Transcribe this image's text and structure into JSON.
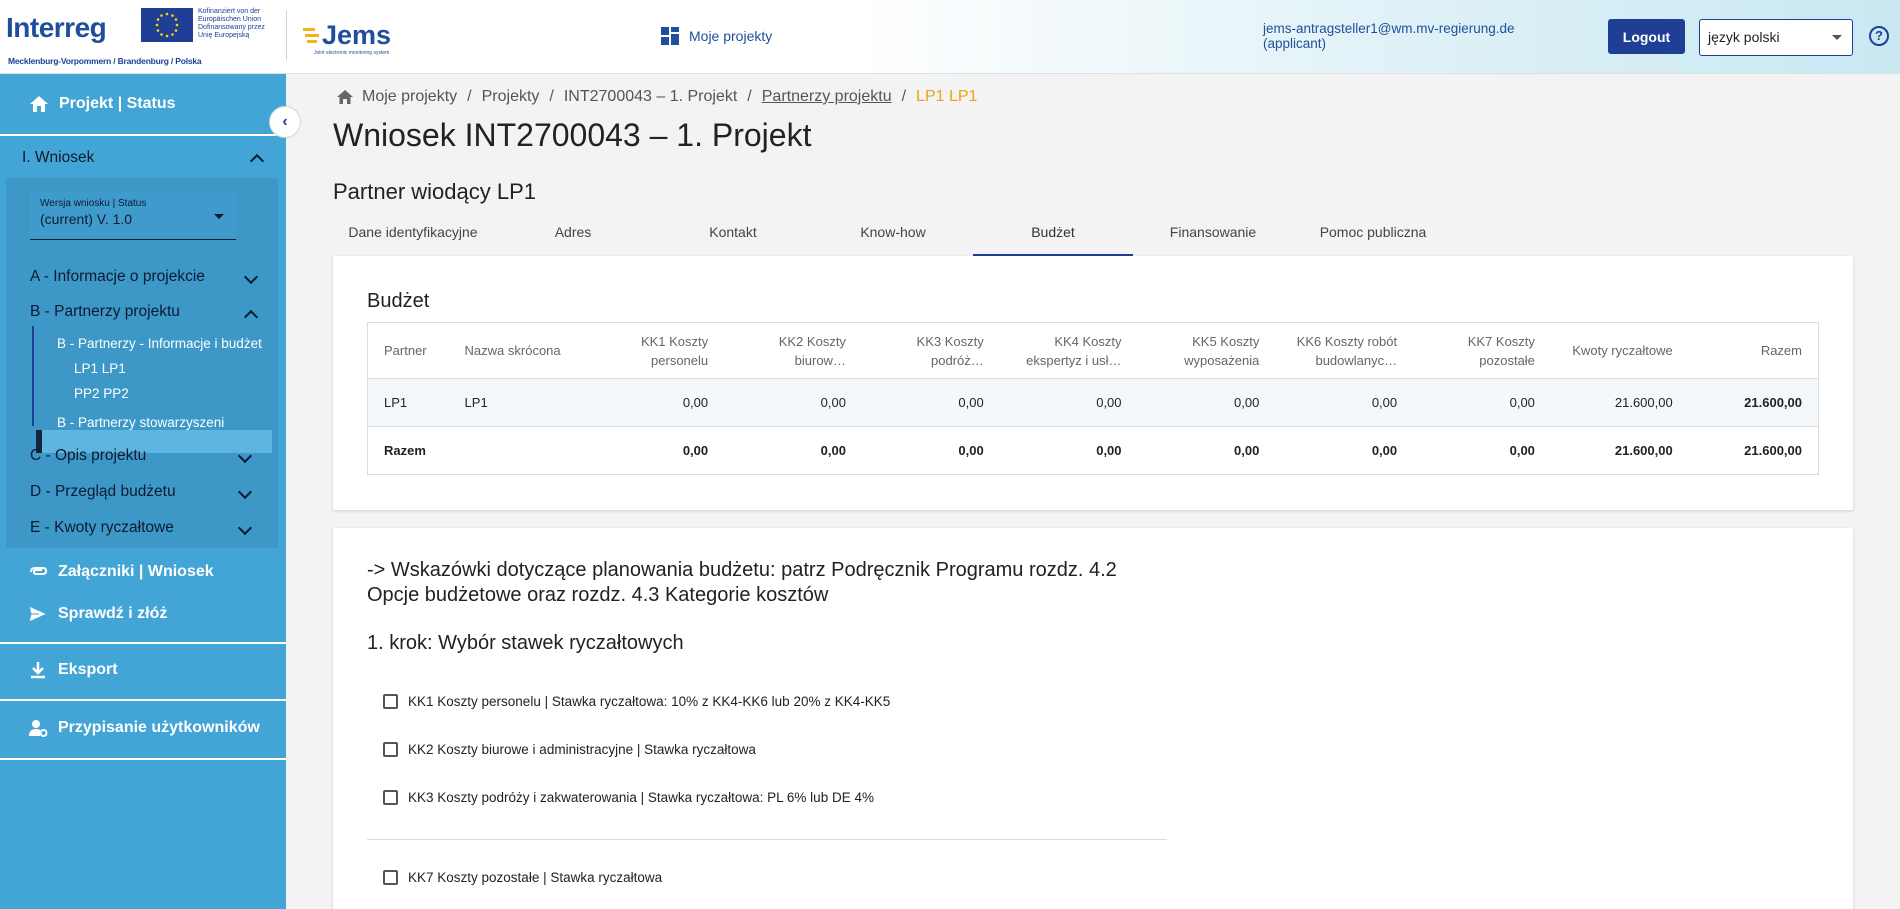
{
  "header": {
    "interreg_word": "Interreg",
    "eu_text": [
      "Kofinanziert von der",
      "Europäischen Union",
      "Dofinansowany przez",
      "Unię Europejską"
    ],
    "region": "Mecklenburg-Vorpommern / Brandenburg / Polska",
    "jems_word": "Jems",
    "jems_sub": "Joint electronic monitoring system",
    "my_projects": "Moje projekty",
    "user_email": "jems-antragsteller1@wm.mv-regierung.de",
    "user_role": "(applicant)",
    "logout": "Logout",
    "language": "język polski",
    "help": "?"
  },
  "sidebar": {
    "top": "Projekt | Status",
    "collapse": "‹",
    "wniosek": "I. Wniosek",
    "version_label": "Wersja wniosku | Status",
    "version_value": "(current) V. 1.0",
    "sections": {
      "a": "A - Informacje o projekcie",
      "b": "B - Partnerzy projektu",
      "b_sub1": "B - Partnerzy - Informacje i budżet",
      "b_lp1": "LP1 LP1",
      "b_pp2": "PP2 PP2",
      "b_sub2": "B - Partnerzy stowarzyszeni",
      "c": "C - Opis projektu",
      "d": "D - Przegląd budżetu",
      "e": "E - Kwoty ryczałtowe"
    },
    "attachments": "Załączniki | Wniosek",
    "check_submit": "Sprawdź i złóż",
    "export": "Eksport",
    "users": "Przypisanie użytkowników"
  },
  "breadcrumb": {
    "home": "Moje projekty",
    "projects": "Projekty",
    "project": "INT2700043 – 1. Projekt",
    "partners": "Partnerzy projektu",
    "current": "LP1 LP1"
  },
  "page_title": "Wniosek INT2700043 – 1. Projekt",
  "sub_title": "Partner wiodący LP1",
  "tabs": [
    "Dane identyfikacyjne",
    "Adres",
    "Kontakt",
    "Know-how",
    "Budżet",
    "Finansowanie",
    "Pomoc publiczna"
  ],
  "budget": {
    "title": "Budżet",
    "headers": {
      "partner": "Partner",
      "short": "Nazwa skrócona",
      "kk1_a": "KK1 Koszty",
      "kk1_b": "personelu",
      "kk2_a": "KK2 Koszty",
      "kk2_b": "biurow…",
      "kk3_a": "KK3 Koszty",
      "kk3_b": "podróż…",
      "kk4_a": "KK4 Koszty",
      "kk4_b": "ekspertyz i usł…",
      "kk5_a": "KK5 Koszty",
      "kk5_b": "wyposażenia",
      "kk6_a": "KK6 Koszty robót",
      "kk6_b": "budowlanyc…",
      "kk7_a": "KK7 Koszty",
      "kk7_b": "pozostałe",
      "lump": "Kwoty ryczałtowe",
      "total": "Razem"
    },
    "rows": [
      {
        "partner": "LP1",
        "short": "LP1",
        "kk1": "0,00",
        "kk2": "0,00",
        "kk3": "0,00",
        "kk4": "0,00",
        "kk5": "0,00",
        "kk6": "0,00",
        "kk7": "0,00",
        "lump": "21.600,00",
        "total": "21.600,00"
      },
      {
        "partner": "Razem",
        "short": "",
        "kk1": "0,00",
        "kk2": "0,00",
        "kk3": "0,00",
        "kk4": "0,00",
        "kk5": "0,00",
        "kk6": "0,00",
        "kk7": "0,00",
        "lump": "21.600,00",
        "total": "21.600,00"
      }
    ]
  },
  "hints": {
    "text_line1": "-> Wskazówki dotyczące planowania budżetu: patrz Podręcznik Programu rozdz. 4.2",
    "text_line2": "Opcje budżetowe oraz rozdz. 4.3 Kategorie kosztów",
    "step": "1. krok: Wybór stawek ryczałtowych",
    "options": [
      "KK1 Koszty personelu | Stawka ryczałtowa: 10% z KK4-KK6 lub 20% z KK4-KK5",
      "KK2 Koszty biurowe i administracyjne | Stawka ryczałtowa",
      "KK3 Koszty podróży i zakwaterowania | Stawka ryczałtowa: PL 6% lub DE 4%",
      "KK7 Koszty pozostałe | Stawka ryczałtowa"
    ]
  }
}
